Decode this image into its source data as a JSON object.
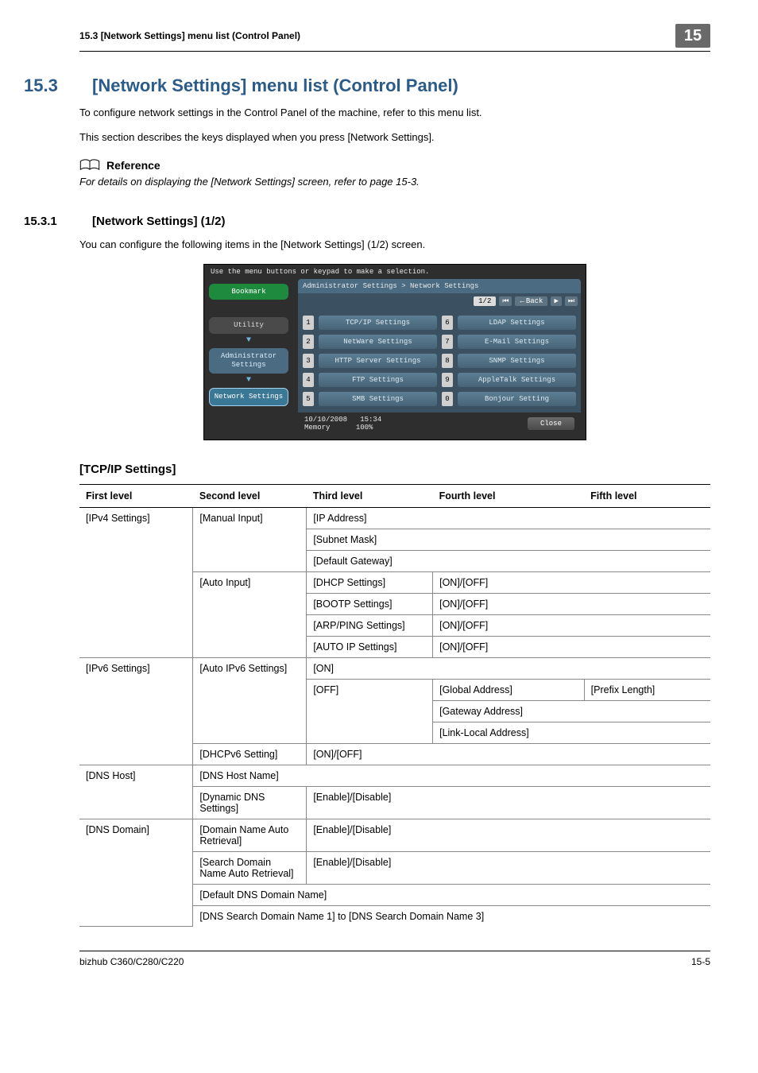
{
  "runningHead": {
    "left": "15.3    [Network Settings] menu list (Control Panel)",
    "badge": "15"
  },
  "section": {
    "num": "15.3",
    "title": "[Network Settings] menu list (Control Panel)",
    "p1": "To configure network settings in the Control Panel of the machine, refer to this menu list.",
    "p2": "This section describes the keys displayed when you press [Network Settings].",
    "refLabel": "Reference",
    "refText": "For details on displaying the [Network Settings] screen, refer to page 15-3."
  },
  "subsection": {
    "num": "15.3.1",
    "title": "[Network Settings] (1/2)",
    "p": "You can configure the following items in the [Network Settings] (1/2) screen."
  },
  "screenshot": {
    "top": "Use the menu buttons or keypad to make a selection.",
    "side": {
      "bookmark": "Bookmark",
      "utility": "Utility",
      "admin": "Administrator Settings",
      "network": "Network Settings"
    },
    "crumb": "Administrator Settings > Network Settings",
    "page": "1/2",
    "back": "Back",
    "items": [
      {
        "n": "1",
        "label": "TCP/IP Settings"
      },
      {
        "n": "2",
        "label": "NetWare Settings"
      },
      {
        "n": "3",
        "label": "HTTP Server Settings"
      },
      {
        "n": "4",
        "label": "FTP Settings"
      },
      {
        "n": "5",
        "label": "SMB Settings"
      },
      {
        "n": "6",
        "label": "LDAP Settings"
      },
      {
        "n": "7",
        "label": "E-Mail Settings"
      },
      {
        "n": "8",
        "label": "SNMP Settings"
      },
      {
        "n": "9",
        "label": "AppleTalk Settings"
      },
      {
        "n": "0",
        "label": "Bonjour Setting"
      }
    ],
    "footer": {
      "date": "10/10/2008",
      "time": "15:34",
      "memLabel": "Memory",
      "mem": "100%",
      "close": "Close"
    }
  },
  "tcpHead": "[TCP/IP Settings]",
  "tableHead": {
    "c1": "First level",
    "c2": "Second level",
    "c3": "Third level",
    "c4": "Fourth level",
    "c5": "Fifth level"
  },
  "tbl": {
    "ipv4": "[IPv4 Settings]",
    "manual": "[Manual Input]",
    "ipaddr": "[IP Address]",
    "subnet": "[Subnet Mask]",
    "gw": "[Default Gateway]",
    "auto": "[Auto Input]",
    "dhcp": "[DHCP Settings]",
    "bootp": "[BOOTP Settings]",
    "arp": "[ARP/PING Settings]",
    "autoip": "[AUTO IP Settings]",
    "onoff": "[ON]/[OFF]",
    "ipv6": "[IPv6 Settings]",
    "autoipv6": "[Auto IPv6 Settings]",
    "on": "[ON]",
    "off": "[OFF]",
    "gaddr": "[Global Address]",
    "plen": "[Prefix Length]",
    "gwaddr": "[Gateway Address]",
    "lladdr": "[Link-Local Address]",
    "dhcpv6": "[DHCPv6 Setting]",
    "dnshost": "[DNS Host]",
    "dnshostname": "[DNS Host Name]",
    "dyndns": "[Dynamic DNS Settings]",
    "endis": "[Enable]/[Disable]",
    "dnsdomain": "[DNS Domain]",
    "domainauto": "[Domain Name Auto Retrieval]",
    "searchauto": "[Search Domain Name Auto Retrieval]",
    "defdns": "[Default DNS Domain Name]",
    "dnssearch": "[DNS Search Domain Name 1] to [DNS Search Domain Name 3]"
  },
  "footer": {
    "left": "bizhub C360/C280/C220",
    "right": "15-5"
  }
}
